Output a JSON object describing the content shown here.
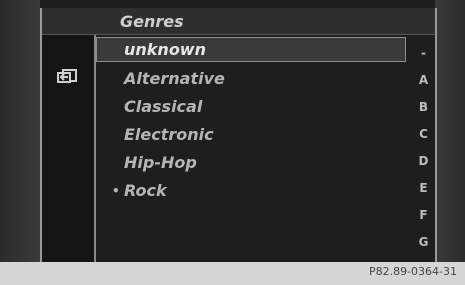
{
  "header": {
    "title": "Genres"
  },
  "list": {
    "items": [
      {
        "label": "unknown",
        "selected": true,
        "bullet": ""
      },
      {
        "label": "Alternative",
        "selected": false,
        "bullet": ""
      },
      {
        "label": "Classical",
        "selected": false,
        "bullet": ""
      },
      {
        "label": "Electronic",
        "selected": false,
        "bullet": ""
      },
      {
        "label": "Hip-Hop",
        "selected": false,
        "bullet": ""
      },
      {
        "label": "Rock",
        "selected": false,
        "bullet": "•"
      }
    ]
  },
  "index_bar": {
    "letters": [
      "-",
      "A",
      "B",
      "C",
      "D",
      "E",
      "F",
      "G"
    ]
  },
  "caption": "P82.89-0364-31",
  "icons": {
    "back": "back-arrow-icon"
  }
}
